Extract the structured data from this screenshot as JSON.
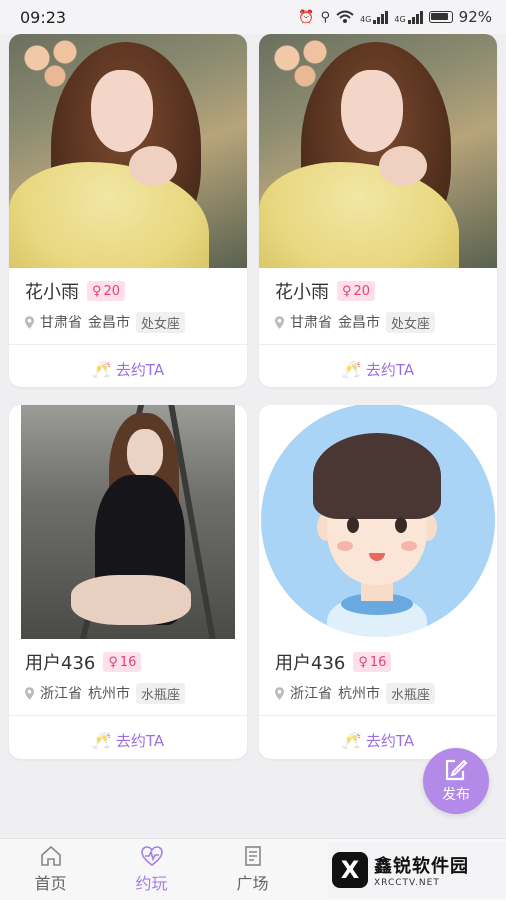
{
  "status_bar": {
    "time": "09:23",
    "battery_percent": "92%",
    "icons": [
      "alarm-icon",
      "location-icon",
      "wifi-icon",
      "signal-4g-icon",
      "signal-4g-icon",
      "battery-icon"
    ],
    "network_labels": [
      "4G",
      "4G"
    ]
  },
  "cards": [
    {
      "name": "花小雨",
      "age": "20",
      "province": "甘肃省",
      "city": "金昌市",
      "zodiac": "处女座",
      "action": "去约TA",
      "photo": "portrait-girl-yellow-sweater"
    },
    {
      "name": "花小雨",
      "age": "20",
      "province": "甘肃省",
      "city": "金昌市",
      "zodiac": "处女座",
      "action": "去约TA",
      "photo": "portrait-girl-yellow-sweater"
    },
    {
      "name": "用户436",
      "age": "16",
      "province": "浙江省",
      "city": "杭州市",
      "zodiac": "水瓶座",
      "action": "去约TA",
      "photo": "woman-on-rail-tracks"
    },
    {
      "name": "用户436",
      "age": "16",
      "province": "浙江省",
      "city": "杭州市",
      "zodiac": "水瓶座",
      "action": "去约TA",
      "photo": "cartoon-boy-avatar"
    }
  ],
  "fab": {
    "label": "发布",
    "icon": "edit-icon"
  },
  "bottom_nav": [
    {
      "label": "首页",
      "icon": "home-icon",
      "active": false
    },
    {
      "label": "约玩",
      "icon": "heartbeat-icon",
      "active": true
    },
    {
      "label": "广场",
      "icon": "notebook-icon",
      "active": false
    }
  ],
  "watermark": {
    "title": "鑫锐软件园",
    "sub": "XRCCTV.NET",
    "logo": "X"
  },
  "colors": {
    "accent": "#a77de6",
    "badge_bg": "#fde0ea",
    "badge_text": "#e0437a",
    "fab": "#b38ae8"
  }
}
